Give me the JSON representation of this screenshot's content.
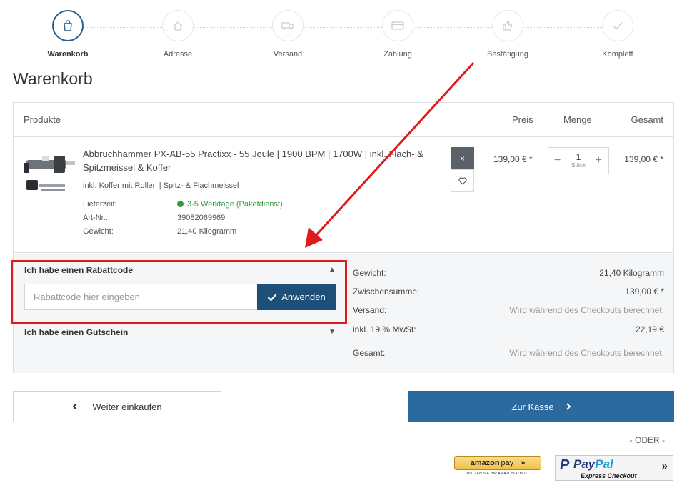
{
  "steps": [
    {
      "label": "Warenkorb",
      "icon": "shopping-bag-icon"
    },
    {
      "label": "Adresse",
      "icon": "home-icon"
    },
    {
      "label": "Versand",
      "icon": "truck-icon"
    },
    {
      "label": "Zahlung",
      "icon": "credit-card-icon"
    },
    {
      "label": "Bestätigung",
      "icon": "thumbs-up-icon"
    },
    {
      "label": "Komplett",
      "icon": "check-icon"
    }
  ],
  "page_title": "Warenkorb",
  "cart_header": {
    "products": "Produkte",
    "price": "Preis",
    "quantity": "Menge",
    "total": "Gesamt"
  },
  "product": {
    "name": "Abbruchhammer PX-AB-55 Practixx - 55 Joule | 1900 BPM | 1700W | inkl. Flach- & Spitzmeissel & Koffer",
    "variant": "inkl. Koffer mit Rollen | Spitz- & Flachmeissel",
    "delivery_label": "Lieferzeit:",
    "delivery_value": "3-5 Werktage (Paketdienst)",
    "sku_label": "Art-Nr.:",
    "sku_value": "39082069969",
    "weight_label": "Gewicht:",
    "weight_value": "21,40 Kilogramm",
    "price": "139,00 € *",
    "quantity": "1",
    "quantity_unit": "Stück",
    "total": "139,00 € *",
    "remove_label": "×"
  },
  "coupon": {
    "title": "Ich habe einen Rabattcode",
    "placeholder": "Rabattcode hier eingeben",
    "apply_label": "Anwenden",
    "voucher_title": "Ich habe einen Gutschein"
  },
  "summary": {
    "weight_label": "Gewicht:",
    "weight_value": "21,40  Kilogramm",
    "subtotal_label": "Zwischensumme:",
    "subtotal_value": "139,00 € *",
    "shipping_label": "Versand:",
    "shipping_value": "Wird während des Checkouts berechnet.",
    "tax_label": "inkl. 19 % MwSt:",
    "tax_value": "22,19 €",
    "total_label": "Gesamt:",
    "total_value": "Wird während des Checkouts berechnet."
  },
  "buttons": {
    "continue": "Weiter einkaufen",
    "checkout": "Zur Kasse",
    "or": "- ODER -"
  },
  "amazon": {
    "brand": "amazon",
    "pay": "pay",
    "sub": "NUTZEN SIE IHR AMAZON-KONTO"
  },
  "paypal": {
    "pay": "Pay",
    "pal": "Pal",
    "sub": "Express Checkout"
  },
  "colors": {
    "accent": "#2a6a9e",
    "dark_button": "#1e4f78",
    "highlight": "#e01a1a",
    "in_stock": "#2c9b3d"
  }
}
